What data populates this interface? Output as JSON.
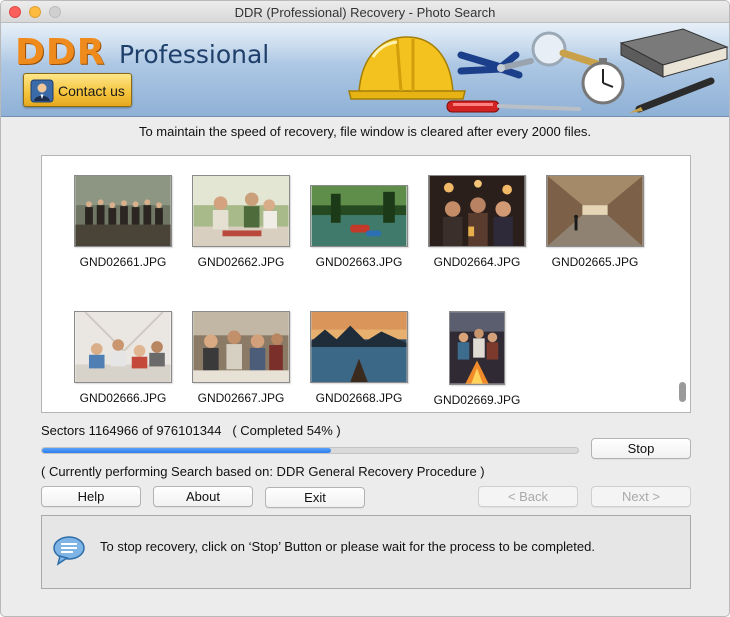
{
  "window": {
    "title": "DDR (Professional) Recovery - Photo Search"
  },
  "header": {
    "brand": "DDR",
    "edition": "Professional",
    "contact_label": "Contact us"
  },
  "notice": "To maintain the speed of recovery, file window is cleared after every 2000 files.",
  "files": [
    {
      "name": "GND02661.JPG"
    },
    {
      "name": "GND02662.JPG"
    },
    {
      "name": "GND02663.JPG"
    },
    {
      "name": "GND02664.JPG"
    },
    {
      "name": "GND02665.JPG"
    },
    {
      "name": "GND02666.JPG"
    },
    {
      "name": "GND02667.JPG"
    },
    {
      "name": "GND02668.JPG"
    },
    {
      "name": "GND02669.JPG"
    }
  ],
  "progress": {
    "sectors_text": "Sectors 1164966 of 976101344",
    "completed_text": "( Completed 54% )",
    "fraction": 0.54,
    "status_text": "( Currently performing Search based on: DDR General Recovery Procedure )"
  },
  "buttons": {
    "stop": "Stop",
    "help": "Help",
    "about": "About",
    "exit": "Exit",
    "back": "< Back",
    "next": "Next >"
  },
  "info": {
    "icon": "speech-bubble-icon",
    "text": "To stop recovery, click on ‘Stop’ Button or please wait for the process to be completed."
  },
  "colors": {
    "progress_fill": "#2d7ef0",
    "brand_orange": "#ef8b1c",
    "banner_blue": "#a7c3e1"
  }
}
